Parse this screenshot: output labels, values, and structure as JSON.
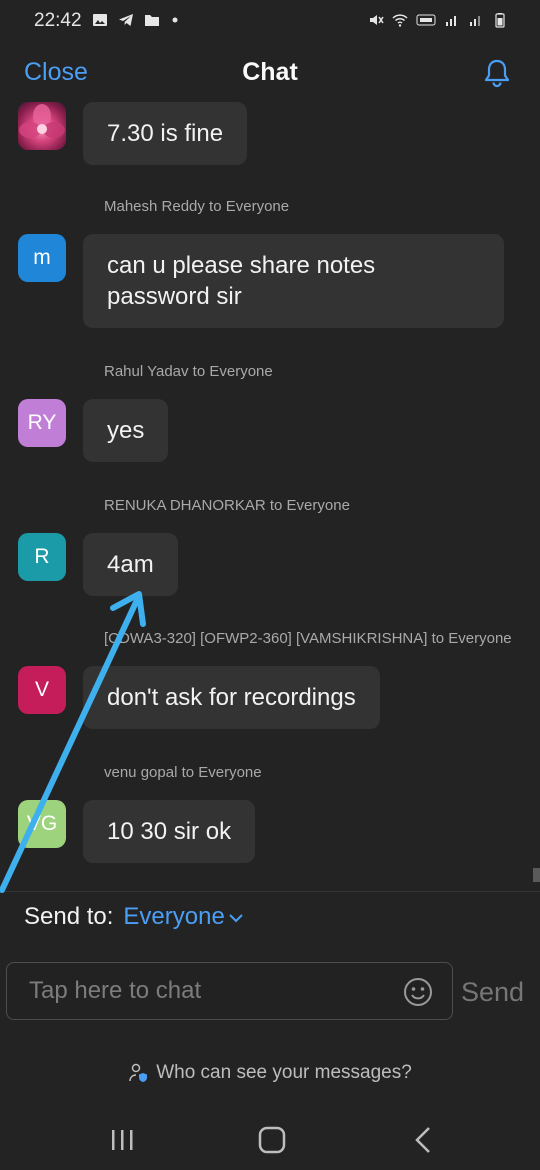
{
  "status_bar": {
    "time": "22:42"
  },
  "header": {
    "close_label": "Close",
    "title": "Chat"
  },
  "messages": [
    {
      "sender": "",
      "avatar_text": "",
      "text": "7.30 is fine"
    },
    {
      "sender": "Mahesh Reddy to Everyone",
      "avatar_text": "m",
      "text": "can u please share notes\npassword sir"
    },
    {
      "sender": "Rahul Yadav to Everyone",
      "avatar_text": "RY",
      "text": "yes"
    },
    {
      "sender": "RENUKA DHANORKAR to Everyone",
      "avatar_text": "R",
      "text": "4am"
    },
    {
      "sender": "[CDWA3-320] [OFWP2-360] [VAMSHIKRISHNA] to Everyone",
      "avatar_text": "V",
      "text": "don't ask for recordings"
    },
    {
      "sender": "venu gopal to Everyone",
      "avatar_text": "VG",
      "text": "10 30 sir ok"
    }
  ],
  "send_to": {
    "label": "Send to:",
    "value": "Everyone"
  },
  "input": {
    "placeholder": "Tap here to chat",
    "value": ""
  },
  "send_label": "Send",
  "privacy_label": "Who can see your messages?",
  "colors": {
    "accent": "#4a9ff5",
    "avatar_m": "#1f86d8",
    "avatar_ry": "#c17ed7",
    "avatar_r": "#1b9aa8",
    "avatar_v": "#c41d5a",
    "avatar_vg": "#9dd37d",
    "annotation_arrow": "#3fb0ee"
  }
}
